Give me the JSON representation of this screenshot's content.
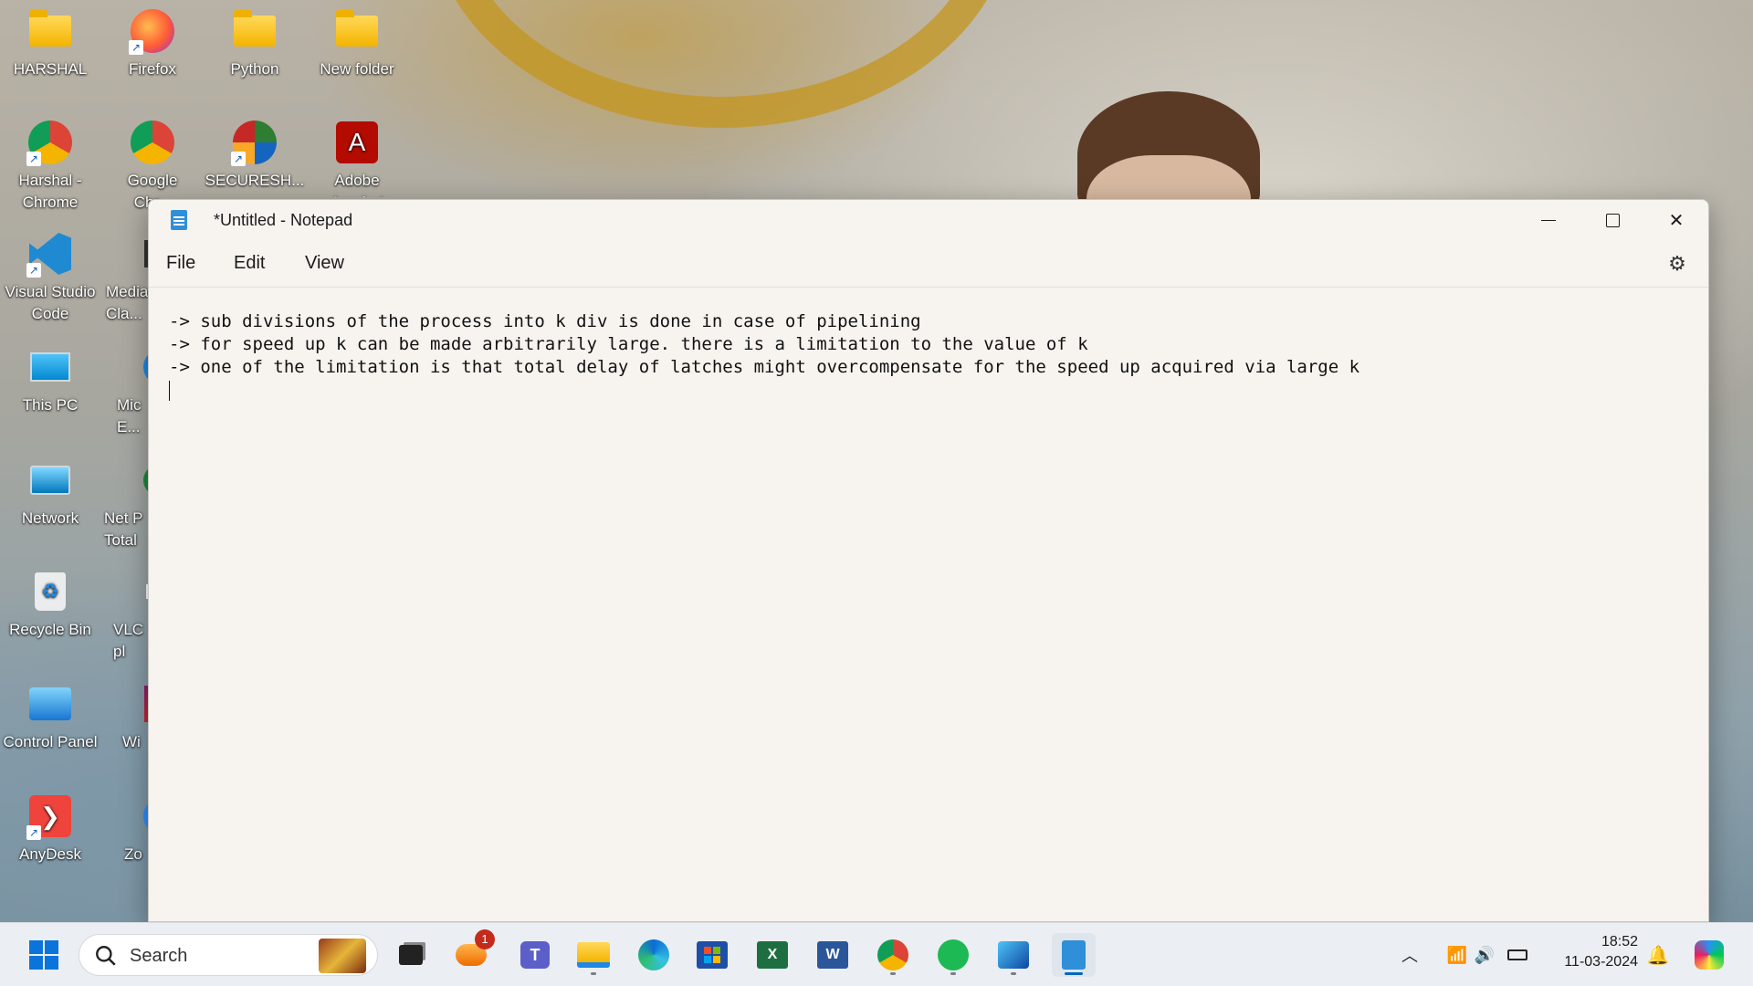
{
  "desktop": {
    "icons": [
      {
        "label": "HARSHAL"
      },
      {
        "label": "Firefox"
      },
      {
        "label": "Python"
      },
      {
        "label": "New folder"
      },
      {
        "label": "Harshal -\nChrome"
      },
      {
        "label": "Google\nChr..."
      },
      {
        "label": "SECURESH..."
      },
      {
        "label": "Adobe\nAcrobat"
      },
      {
        "label": "Visual Studio\nCode"
      },
      {
        "label": "Media\nCla..."
      },
      {
        "label": "This PC"
      },
      {
        "label": "Mic\nE..."
      },
      {
        "label": "Network"
      },
      {
        "label": "Net P\nTotal"
      },
      {
        "label": "Recycle Bin"
      },
      {
        "label": "VLC\npl"
      },
      {
        "label": "Control Panel"
      },
      {
        "label": "Wi"
      },
      {
        "label": "AnyDesk"
      },
      {
        "label": "Zo"
      }
    ]
  },
  "notepad": {
    "title": "*Untitled - Notepad",
    "menu": {
      "file": "File",
      "edit": "Edit",
      "view": "View"
    },
    "icons": {
      "minimize": "minimize-icon",
      "maximize": "maximize-icon",
      "close": "close-icon",
      "settings": "gear-icon"
    },
    "lines": [
      "-> sub divisions of the process into k div is done in case of pipelining",
      "-> for speed up k can be made arbitrarily large. there is a limitation to the value of k",
      "-> one of the limitation is that total delay of latches might overcompensate for the speed up acquired via large k"
    ]
  },
  "taskbar": {
    "search_label": "Search",
    "apps": [
      "start",
      "search",
      "task-view",
      "weather",
      "teams",
      "file-explorer",
      "edge",
      "store",
      "excel",
      "word",
      "chrome",
      "spotify",
      "photos",
      "notepad"
    ],
    "weather_badge": "1",
    "time": "18:52",
    "date": "11-03-2024",
    "accent": "#0067c0"
  }
}
